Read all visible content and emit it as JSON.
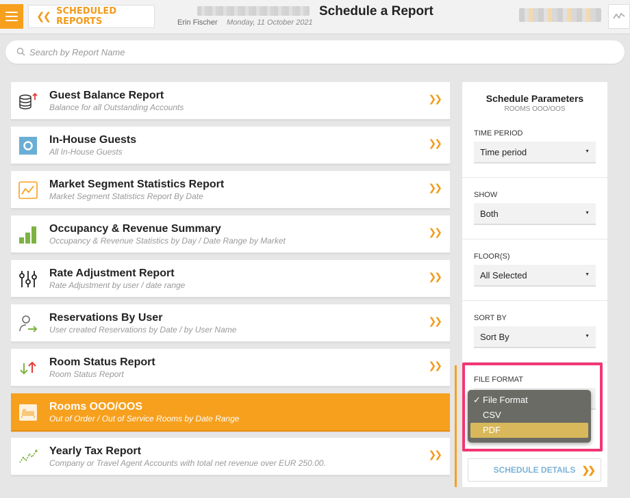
{
  "header": {
    "back_label": "SCHEDULED REPORTS",
    "user_name": "Erin Fischer",
    "date": "Monday, 11 October 2021",
    "page_title": "Schedule a Report"
  },
  "search": {
    "placeholder": "Search by Report Name"
  },
  "reports": [
    {
      "title": "Guest Balance Report",
      "subtitle": "Balance for all Outstanding Accounts",
      "icon": "coins-icon"
    },
    {
      "title": "In-House Guests",
      "subtitle": "All In-House Guests",
      "icon": "in-house-icon"
    },
    {
      "title": "Market Segment Statistics Report",
      "subtitle": "Market Segment Statistics Report By Date",
      "icon": "line-chart-icon"
    },
    {
      "title": "Occupancy & Revenue Summary",
      "subtitle": "Occupancy & Revenue Statistics by Day / Date Range by Market",
      "icon": "bar-chart-icon"
    },
    {
      "title": "Rate Adjustment Report",
      "subtitle": "Rate Adjustment by user / date range",
      "icon": "sliders-icon"
    },
    {
      "title": "Reservations By User",
      "subtitle": "User created Reservations by Date / by User Name",
      "icon": "user-arrow-icon"
    },
    {
      "title": "Room Status Report",
      "subtitle": "Room Status Report",
      "icon": "up-down-arrows-icon"
    },
    {
      "title": "Rooms OOO/OOS",
      "subtitle": "Out of Order / Out of Service Rooms by Date Range",
      "icon": "bed-icon"
    },
    {
      "title": "Yearly Tax Report",
      "subtitle": "Company or Travel Agent Accounts with total net revenue over EUR 250.00.",
      "icon": "trend-icon"
    }
  ],
  "panel": {
    "title": "Schedule Parameters",
    "subtitle": "ROOMS OOO/OOS",
    "time_period_label": "TIME PERIOD",
    "time_period_value": "Time period",
    "show_label": "SHOW",
    "show_value": "Both",
    "floors_label": "FLOOR(S)",
    "floors_value": "All Selected",
    "sort_label": "SORT BY",
    "sort_value": "Sort By",
    "format_label": "FILE FORMAT"
  },
  "format_dropdown": {
    "options": [
      "File Format",
      "CSV",
      "PDF"
    ],
    "checked": "File Format",
    "highlighted": "PDF"
  },
  "schedule_details_label": "SCHEDULE DETAILS",
  "colors": {
    "accent": "#f7a01e",
    "highlight": "#f23673"
  }
}
